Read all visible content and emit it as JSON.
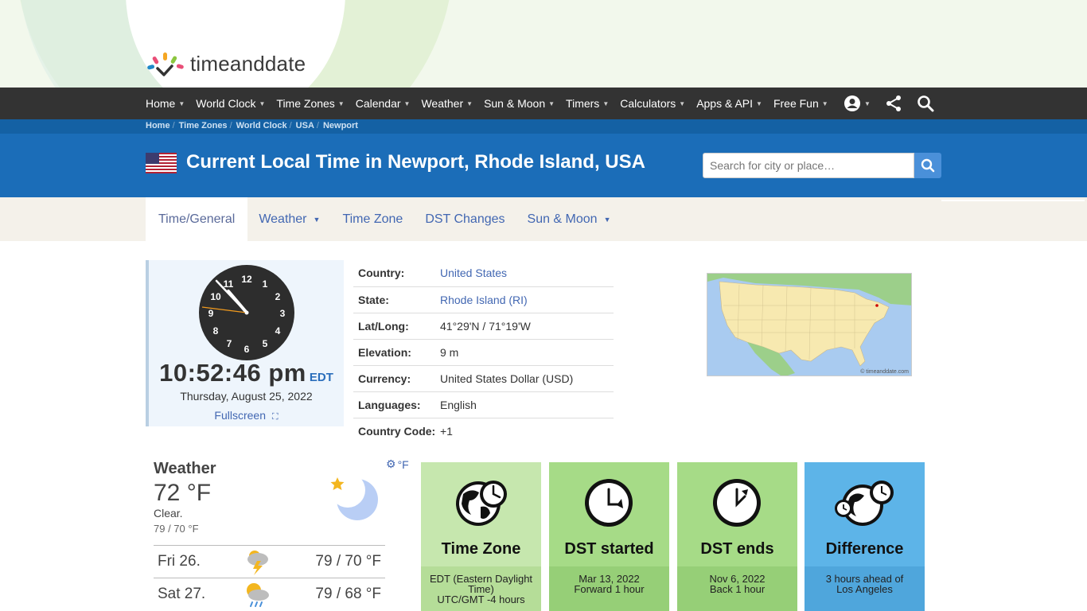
{
  "logo": {
    "text": "timeanddate"
  },
  "nav": {
    "items": [
      {
        "label": "Home"
      },
      {
        "label": "World Clock"
      },
      {
        "label": "Time Zones"
      },
      {
        "label": "Calendar"
      },
      {
        "label": "Weather"
      },
      {
        "label": "Sun & Moon"
      },
      {
        "label": "Timers"
      },
      {
        "label": "Calculators"
      },
      {
        "label": "Apps & API"
      },
      {
        "label": "Free Fun"
      }
    ],
    "icons": [
      "account-icon",
      "share-icon",
      "search-icon"
    ]
  },
  "breadcrumb": [
    "Home",
    "Time Zones",
    "World Clock",
    "USA",
    "Newport"
  ],
  "page": {
    "title": "Current Local Time in Newport, Rhode Island, USA",
    "search_placeholder": "Search for city or place…"
  },
  "tabs": [
    {
      "label": "Time/General",
      "active": true,
      "dropdown": false
    },
    {
      "label": "Weather",
      "active": false,
      "dropdown": true
    },
    {
      "label": "Time Zone",
      "active": false,
      "dropdown": false
    },
    {
      "label": "DST Changes",
      "active": false,
      "dropdown": false
    },
    {
      "label": "Sun & Moon",
      "active": false,
      "dropdown": true
    }
  ],
  "clock": {
    "numerals": [
      "12",
      "1",
      "2",
      "3",
      "4",
      "5",
      "6",
      "7",
      "8",
      "9",
      "10",
      "11"
    ],
    "time": "10:52:46 pm",
    "tz": "EDT",
    "date": "Thursday, August 25, 2022",
    "fullscreen": "Fullscreen"
  },
  "info": [
    {
      "label": "Country:",
      "value": "United States",
      "link": true
    },
    {
      "label": "State:",
      "value": "Rhode Island (RI)",
      "link": true
    },
    {
      "label": "Lat/Long:",
      "value": "41°29'N / 71°19'W",
      "link": false
    },
    {
      "label": "Elevation:",
      "value": "9 m",
      "link": false
    },
    {
      "label": "Currency:",
      "value": "United States Dollar (USD)",
      "link": false
    },
    {
      "label": "Languages:",
      "value": "English",
      "link": false
    },
    {
      "label": "Country Code:",
      "value": "+1",
      "link": false
    }
  ],
  "map": {
    "credit": "© timeanddate.com"
  },
  "weather": {
    "heading": "Weather",
    "units": "°F",
    "temp": "72 °F",
    "condition": "Clear.",
    "hilo": "79 / 70 °F",
    "forecast": [
      {
        "day": "Fri 26.",
        "temps": "79 / 70 °F",
        "icon": "thunderstorm-icon"
      },
      {
        "day": "Sat 27.",
        "temps": "79 / 68 °F",
        "icon": "sun-rain-icon"
      }
    ]
  },
  "tiles": [
    {
      "title": "Time Zone",
      "line1": "EDT (Eastern Daylight Time)",
      "line2": "UTC/GMT -4 hours",
      "color": "#c6e7ae",
      "bottom": "#b5dd98"
    },
    {
      "title": "DST started",
      "line1": "Mar 13, 2022",
      "line2": "Forward 1 hour",
      "color": "#a6db87",
      "bottom": "#96cf77"
    },
    {
      "title": "DST ends",
      "line1": "Nov 6, 2022",
      "line2": "Back 1 hour",
      "color": "#a6db87",
      "bottom": "#96cf77"
    },
    {
      "title": "Difference",
      "line1": "3 hours ahead of",
      "line2": "Los Angeles",
      "color": "#5db4e8",
      "bottom": "#4fa6dc"
    }
  ]
}
